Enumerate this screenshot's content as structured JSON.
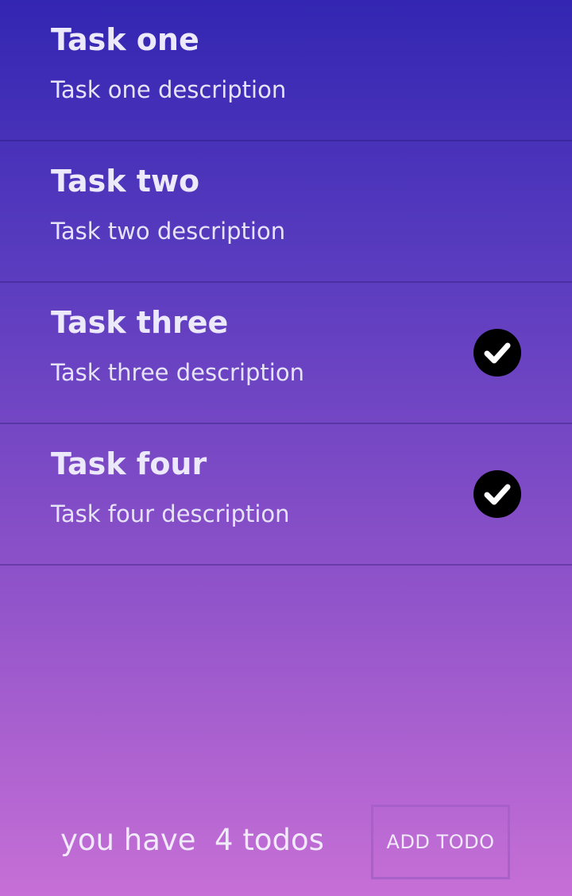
{
  "tasks": [
    {
      "title": "Task one",
      "description": "Task one description",
      "done": false
    },
    {
      "title": "Task two",
      "description": "Task two description",
      "done": false
    },
    {
      "title": "Task three",
      "description": "Task three description",
      "done": true
    },
    {
      "title": "Task four",
      "description": "Task four description",
      "done": true
    }
  ],
  "footer": {
    "count_text": "you have  4 todos",
    "add_button_label": "ADD TODO"
  },
  "icons": {
    "done": "check-circle-icon"
  },
  "colors": {
    "gradient_top": "#3326b2",
    "gradient_bottom": "#c66fd6",
    "check_fill": "#000000"
  }
}
